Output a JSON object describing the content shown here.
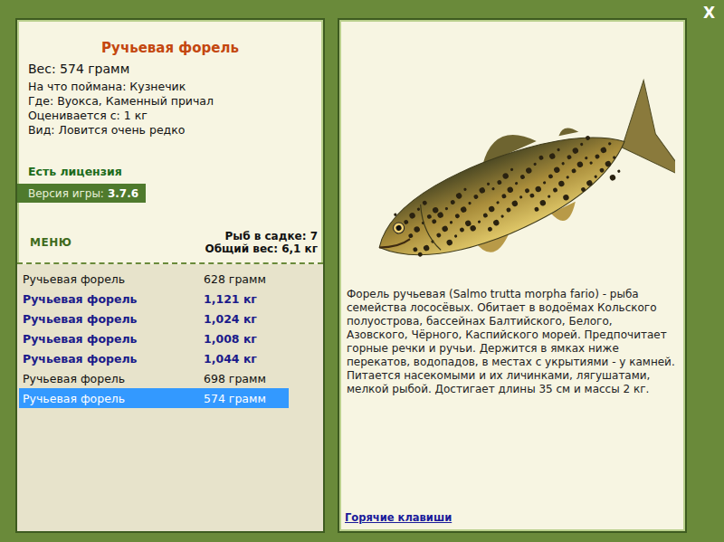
{
  "fish": {
    "name": "Ручьевая форель",
    "weight": "Вес: 574 грамм",
    "details": [
      "На что поймана: Кузнечик",
      "Где: Вуокса, Каменный причал",
      "Оценивается с: 1 кг",
      "Вид: Ловится очень редко"
    ]
  },
  "license": "Есть лицензия",
  "version": {
    "label": "Версия игры:",
    "value": "3.7.6"
  },
  "menu": "МЕНЮ",
  "keepnet": {
    "count": "Рыб в садке: 7",
    "total": "Общий вес: 6,1 кг"
  },
  "catches": [
    {
      "name": "Ручьевая форель",
      "weight": "628 грамм",
      "trophy": false,
      "selected": false
    },
    {
      "name": "Ручьевая форель",
      "weight": "1,121 кг",
      "trophy": true,
      "selected": false
    },
    {
      "name": "Ручьевая форель",
      "weight": "1,024 кг",
      "trophy": true,
      "selected": false
    },
    {
      "name": "Ручьевая форель",
      "weight": "1,008 кг",
      "trophy": true,
      "selected": false
    },
    {
      "name": "Ручьевая форель",
      "weight": "1,044 кг",
      "trophy": true,
      "selected": false
    },
    {
      "name": "Ручьевая форель",
      "weight": "698 грамм",
      "trophy": false,
      "selected": false
    },
    {
      "name": "Ручьевая форель",
      "weight": "574 грамм",
      "trophy": false,
      "selected": true
    }
  ],
  "description": "Форель ручьевая (Salmo trutta morpha fario) - рыба семейства лососёвых. Обитает в водоёмах Кольского полуострова, бассейнах Балтийского, Белого, Азовского, Чёрного, Каспийского морей. Предпочитает горные речки и ручьи. Держится в ямках ниже перекатов, водопадов, в местах с укрытиями - у камней. Питается насекомыми и их личинками, лягушатами, мелкой рыбой. Достигает длины 35 см и массы 2 кг.",
  "hotkeys": "Горячие клавиши",
  "close": "X"
}
